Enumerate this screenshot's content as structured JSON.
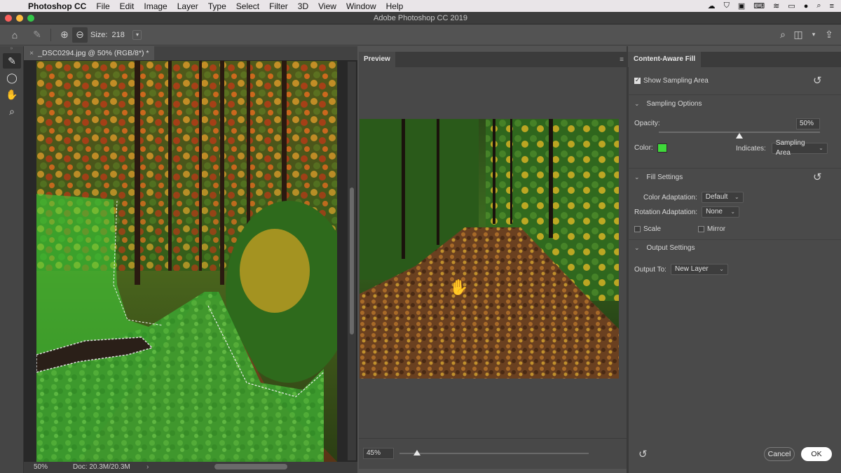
{
  "menubar": {
    "app_name": "Photoshop CC",
    "items": [
      "File",
      "Edit",
      "Image",
      "Layer",
      "Type",
      "Select",
      "Filter",
      "3D",
      "View",
      "Window",
      "Help"
    ]
  },
  "window": {
    "title": "Adobe Photoshop CC 2019"
  },
  "options_bar": {
    "size_label": "Size:",
    "size_value": "218"
  },
  "document": {
    "tab_title": "_DSC0294.jpg @ 50% (RGB/8*) *",
    "zoom": "50%",
    "doc_info": "Doc: 20.3M/20.3M"
  },
  "preview": {
    "tab_label": "Preview",
    "zoom": "45%",
    "zoom_level": 0.45
  },
  "caf": {
    "tab_label": "Content-Aware Fill",
    "show_sampling_area": "Show Sampling Area",
    "sampling_options": "Sampling Options",
    "opacity_label": "Opacity:",
    "opacity_value": "50%",
    "color_label": "Color:",
    "sampling_color": "#3fd93a",
    "indicates_label": "Indicates:",
    "indicates_value": "Sampling Area",
    "fill_settings": "Fill Settings",
    "color_adaptation_label": "Color Adaptation:",
    "color_adaptation_value": "Default",
    "rotation_adaptation_label": "Rotation Adaptation:",
    "rotation_adaptation_value": "None",
    "scale_label": "Scale",
    "mirror_label": "Mirror",
    "output_settings": "Output Settings",
    "output_to_label": "Output To:",
    "output_to_value": "New Layer",
    "cancel_label": "Cancel",
    "ok_label": "OK"
  }
}
